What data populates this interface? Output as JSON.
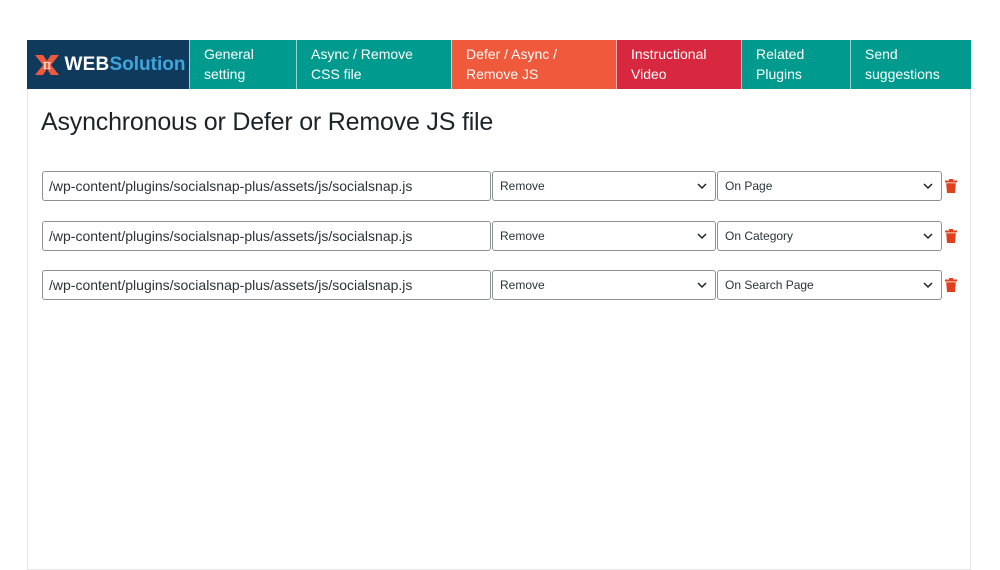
{
  "brand": {
    "logo_web": "WEB",
    "logo_solution": "Solution"
  },
  "tabs": [
    {
      "label": "General\nsetting",
      "color": "#009a8f"
    },
    {
      "label": "Async / Remove\nCSS file",
      "color": "#009a8f"
    },
    {
      "label": "Defer / Async /\nRemove JS",
      "color": "#ef5a3c"
    },
    {
      "label": "Instructional\nVideo",
      "color": "#d8283f"
    },
    {
      "label": "Related\nPlugins",
      "color": "#009a8f"
    },
    {
      "label": "Send\nsuggestions",
      "color": "#009a8f"
    }
  ],
  "page_title": "Asynchronous or Defer or Remove JS file",
  "rows": [
    {
      "path": "/wp-content/plugins/socialsnap-plus/assets/js/socialsnap.js",
      "action": "Remove",
      "where": "On Page"
    },
    {
      "path": "/wp-content/plugins/socialsnap-plus/assets/js/socialsnap.js",
      "action": "Remove",
      "where": "On Category"
    },
    {
      "path": "/wp-content/plugins/socialsnap-plus/assets/js/socialsnap.js",
      "action": "Remove",
      "where": "On Search Page"
    }
  ],
  "icons": {
    "delete": "trash-icon",
    "dropdown": "chevron-down-icon",
    "logo": "pi-x-logo-icon"
  },
  "colors": {
    "logo_bg": "#103a5c",
    "teal": "#009a8f",
    "orange": "#ef5a3c",
    "red": "#d8283f",
    "trash": "#e2401c"
  }
}
